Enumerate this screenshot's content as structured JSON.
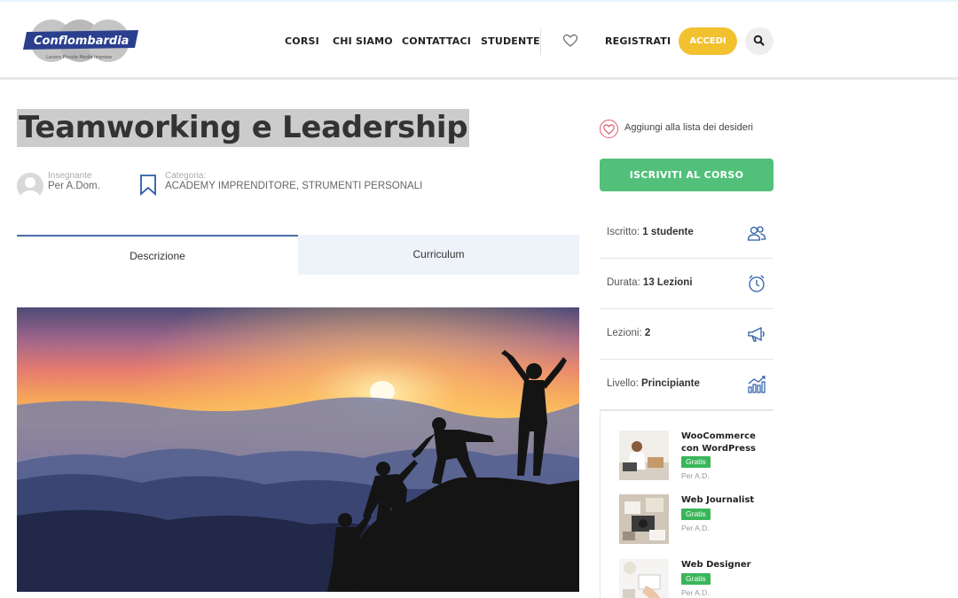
{
  "logo": {
    "text": "Conflombardia",
    "tagline": "Lavoro Piccole Medie Imprese"
  },
  "nav": {
    "items": [
      "CORSI",
      "CHI SIAMO",
      "CONTATTACI",
      "STUDENTE"
    ],
    "register": "REGISTRATI",
    "login": "ACCEDI"
  },
  "course": {
    "title": "Teamworking e Leadership",
    "teacher_label": "Insegnante",
    "teacher": "Per A.Dom.",
    "category_label": "Categoria:",
    "category": "ACADEMY IMPRENDITORE, STRUMENTI PERSONALI"
  },
  "tabs": [
    "Descrizione",
    "Curriculum"
  ],
  "sidebar": {
    "wishlist": "Aggiungi alla lista dei desideri",
    "enroll": "ISCRIVITI AL CORSO",
    "info": [
      {
        "label": "Iscritto:",
        "value": "1 studente",
        "icon": "users-icon"
      },
      {
        "label": "Durata:",
        "value": "13 Lezioni",
        "icon": "clock-icon"
      },
      {
        "label": "Lezioni:",
        "value": "2",
        "icon": "megaphone-icon"
      },
      {
        "label": "Livello:",
        "value": "Principiante",
        "icon": "bar-chart-icon"
      }
    ]
  },
  "related": [
    {
      "title": "WooCommerce con WordPress",
      "badge": "Gratis",
      "author": "Per A.D."
    },
    {
      "title": "Web Journalist",
      "badge": "Gratis",
      "author": "Per A.D."
    },
    {
      "title": "Web Designer",
      "badge": "Gratis",
      "author": "Per A.D."
    }
  ],
  "colors": {
    "accent": "#f2c12e",
    "enroll": "#52c07a",
    "badge": "#3ab65a",
    "tab_border": "#4a6fa5"
  }
}
